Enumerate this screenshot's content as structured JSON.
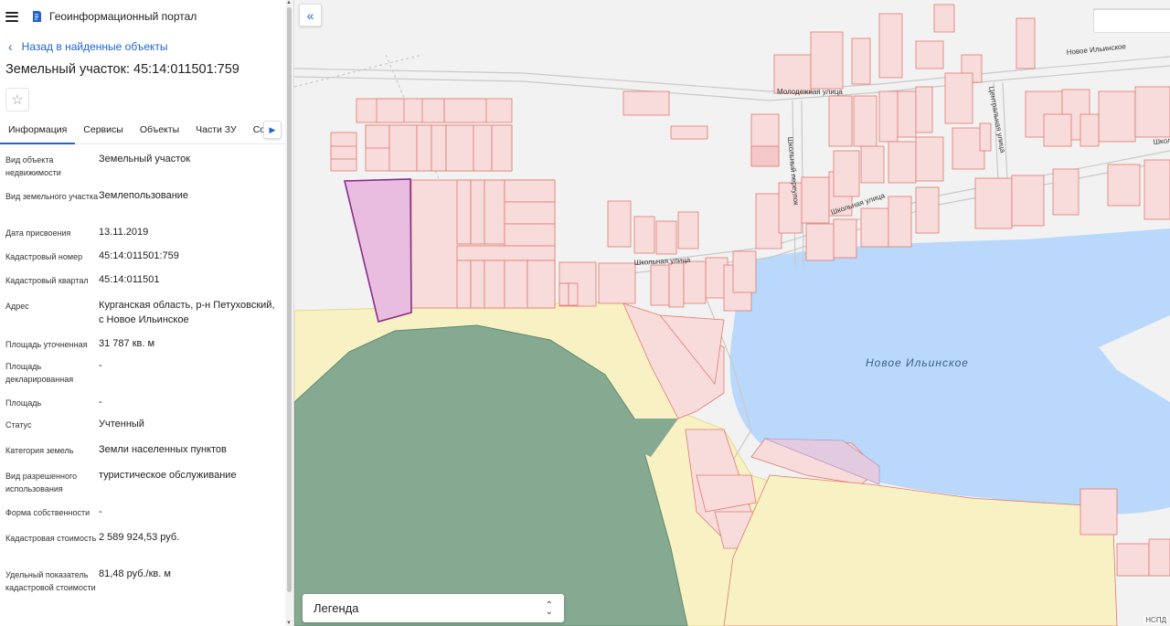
{
  "header": {
    "title": "Геоинформационный портал"
  },
  "back_label": "Назад в найденные объекты",
  "object_title": "Земельный участок: 45:14:011501:759",
  "tabs": [
    "Информация",
    "Сервисы",
    "Объекты",
    "Части ЗУ",
    "Сост"
  ],
  "properties": [
    {
      "k": "Вид объекта недвижимости",
      "v": "Земельный участок"
    },
    {
      "k": "Вид земельного участка",
      "v": "Землепользование"
    },
    {
      "k": "Дата присвоения",
      "v": "13.11.2019"
    },
    {
      "k": "Кадастровый номер",
      "v": "45:14:011501:759"
    },
    {
      "k": "Кадастровый квартал",
      "v": "45:14:011501"
    },
    {
      "k": "Адрес",
      "v": "Курганская область, р-н Петуховский, с Новое Ильинское"
    },
    {
      "k": "Площадь уточненная",
      "v": "31 787 кв. м"
    },
    {
      "k": "Площадь декларированная",
      "v": "-"
    },
    {
      "k": "Площадь",
      "v": "-"
    },
    {
      "k": "Статус",
      "v": "Учтенный"
    },
    {
      "k": "Категория земель",
      "v": "Земли населенных пунктов"
    },
    {
      "k": "Вид разрешенного использования",
      "v": "туристическое обслуживание"
    },
    {
      "k": "Форма собственности",
      "v": "-"
    },
    {
      "k": "Кадастровая стоимость",
      "v": "2 589 924,53 руб."
    },
    {
      "k": "Удельный показатель кадастровой стоимости",
      "v": "81,48 руб./кв. м"
    }
  ],
  "map": {
    "streets": {
      "molodezhnaya": "Молодежная улица",
      "novoe_ilinskoe": "Новое Ильинское",
      "tsentralnaya": "Центральная улица",
      "shkolnaya": "Школьная улица",
      "shkolnaya_short": "Школ",
      "pereulok": "Школьный переулок"
    },
    "lake_label": "Новое Ильинское",
    "legend_label": "Легенда",
    "credit": "НСПД",
    "colors": {
      "parcel_fill": "#f8dcdc",
      "parcel_stroke": "#e07a6e",
      "selected_fill": "#e8bde0",
      "selected_stroke": "#8a2c8a",
      "water": "#b9d8fb",
      "forest": "#86a992",
      "sand": "#f7f1c4",
      "accent": "#1d63d6"
    }
  }
}
